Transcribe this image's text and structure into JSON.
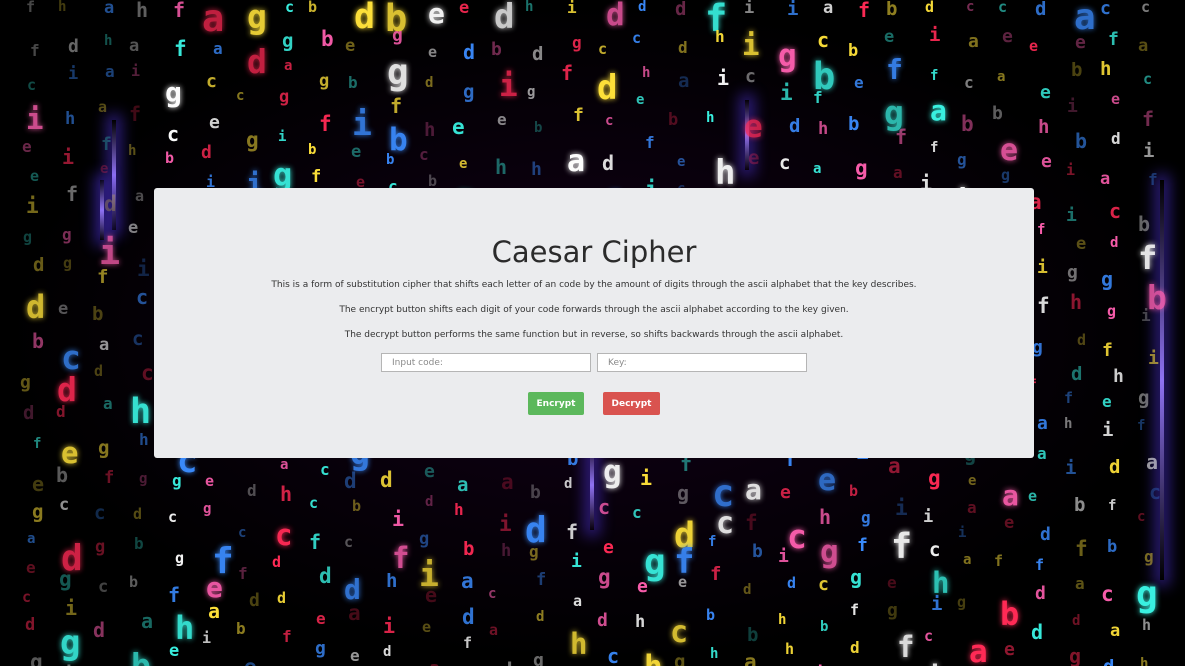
{
  "cipher": {
    "title": "Caesar Cipher",
    "descriptions": [
      "This is a form of substitution cipher that shifts each letter of an code by the amount of digits through the ascii alphabet that the key describes.",
      "The encrypt button shifts each digit of your code forwards through the ascii alphabet according to the key given.",
      "The decrypt button performs the same function but in reverse, so shifts backwards through the ascii alphabet."
    ],
    "code_input": {
      "placeholder": "Input code:",
      "value": ""
    },
    "key_input": {
      "placeholder": "Key:",
      "value": ""
    },
    "encrypt_label": "Encrypt",
    "decrypt_label": "Decrypt",
    "colors": {
      "panel_bg": "#ebecee",
      "encrypt": "#5cb85c",
      "decrypt": "#d9534f"
    }
  },
  "background": {
    "type": "falling-letters",
    "letters": [
      "a",
      "b",
      "c",
      "d",
      "e",
      "f",
      "g",
      "h",
      "i"
    ],
    "palette": [
      "#ff2a55",
      "#ffe23a",
      "#39f0e0",
      "#ffffff",
      "#3b8cff",
      "#ff5fb0"
    ]
  }
}
